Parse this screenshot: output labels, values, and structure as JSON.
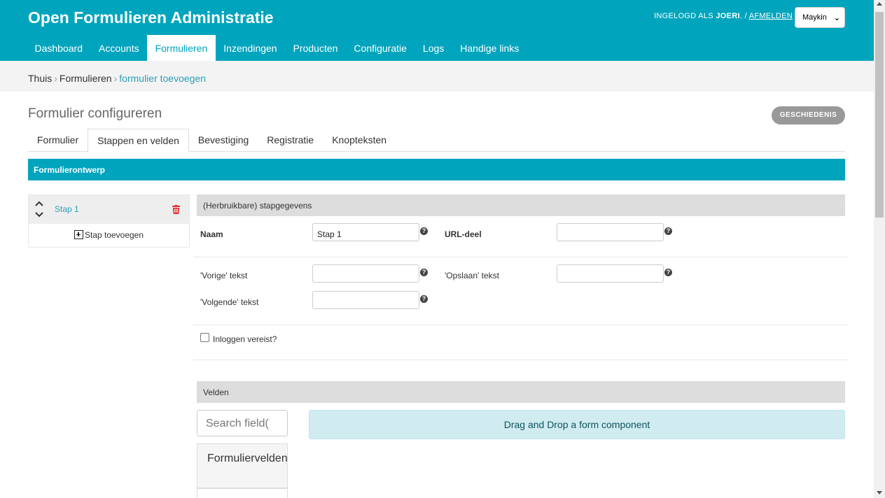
{
  "header": {
    "brand": "Open Formulieren Administratie",
    "logged_in_prefix": "INGELOGD ALS",
    "username": "JOERI",
    "logout": "AFMELDEN",
    "org_selected": "Maykin"
  },
  "nav": {
    "items": [
      {
        "label": "Dashboard"
      },
      {
        "label": "Accounts"
      },
      {
        "label": "Formulieren",
        "active": true
      },
      {
        "label": "Inzendingen"
      },
      {
        "label": "Producten"
      },
      {
        "label": "Configuratie"
      },
      {
        "label": "Logs"
      },
      {
        "label": "Handige links"
      }
    ]
  },
  "breadcrumbs": {
    "home": "Thuis",
    "forms": "Formulieren",
    "current": "formulier toevoegen"
  },
  "page": {
    "title": "Formulier configureren",
    "history_button": "GESCHIEDENIS"
  },
  "tabs": [
    {
      "label": "Formulier"
    },
    {
      "label": "Stappen en velden",
      "active": true
    },
    {
      "label": "Bevestiging"
    },
    {
      "label": "Registratie"
    },
    {
      "label": "Knopteksten"
    }
  ],
  "designer": {
    "section_title": "Formulierontwerp",
    "steps": [
      {
        "label": "Stap 1"
      }
    ],
    "add_step": "Stap toevoegen"
  },
  "step_details": {
    "heading": "(Herbruikbare) stapgegevens",
    "name_label": "Naam",
    "name_value": "Stap 1",
    "slug_label": "URL-deel",
    "slug_value": "",
    "previous_label": "'Vorige' tekst",
    "save_label": "'Opslaan' tekst",
    "next_label": "'Volgende' tekst",
    "login_required_label": "Inloggen vereist?"
  },
  "fields": {
    "heading": "Velden",
    "search_placeholder": "Search field(",
    "group_label": "Formuliervelden",
    "dropzone_text": "Drag and Drop a form component"
  },
  "colors": {
    "primary": "#00a5bd",
    "link": "#2a9fb5",
    "danger": "#e03131",
    "info_bg": "#d1ecf1"
  }
}
